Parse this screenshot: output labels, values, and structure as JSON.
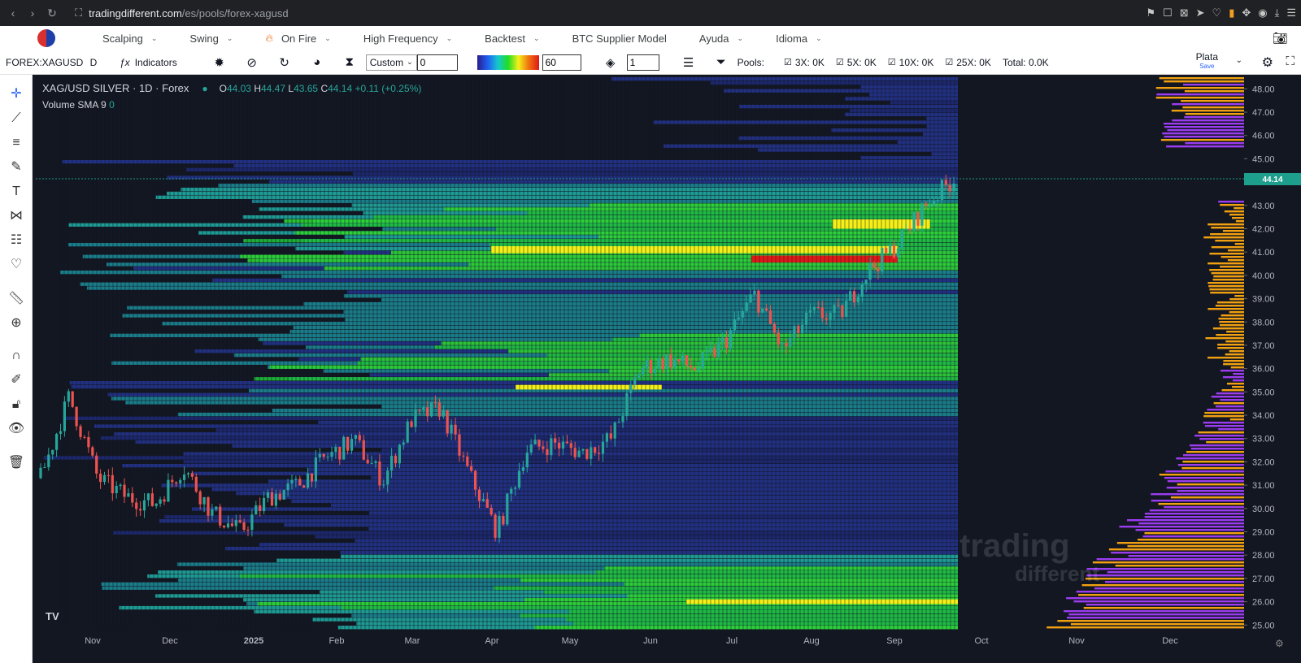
{
  "browser": {
    "back": "‹",
    "forward": "›",
    "reload": "↻",
    "url_domain": "tradingdifferent.com",
    "url_path": "/es/pools/forex-xagusd"
  },
  "site_nav": {
    "items": [
      {
        "label": "Scalping"
      },
      {
        "label": "Swing"
      },
      {
        "label": "On Fire"
      },
      {
        "label": "High Frequency"
      },
      {
        "label": "Backtest"
      },
      {
        "label": "BTC Supplier Model"
      },
      {
        "label": "Ayuda"
      },
      {
        "label": "Idioma"
      }
    ]
  },
  "toolbar": {
    "symbol": "FOREX:XAGUSD",
    "timeframe": "D",
    "indicators_label": "Indicators",
    "mode_select": "Custom",
    "custom_value": "0",
    "gradient_value": "60",
    "layers_value": "1",
    "pools_label": "Pools:",
    "pools": [
      "3X: 0K",
      "5X: 0K",
      "10X: 0K",
      "25X: 0K"
    ],
    "total": "Total: 0.0K",
    "asset_name": "Plata",
    "save_label": "Save"
  },
  "legend": {
    "title": "XAG/USD SILVER · 1D · Forex",
    "o_label": "O",
    "o_value": "44.03",
    "h_label": "H",
    "h_value": "44.47",
    "l_label": "L",
    "l_value": "43.65",
    "c_label": "C",
    "c_value": "44.14",
    "change": "+0.11 (+0.25%)",
    "volume_label": "Volume SMA 9",
    "volume_value": "0"
  },
  "watermark": {
    "line1": "trading",
    "line2": "different"
  },
  "colors": {
    "background": "#131722",
    "bull": "#26a69a",
    "bear": "#ef5350",
    "price_badge": "#1e9e8c",
    "profile_purple": "#9b3cf0",
    "profile_orange": "#f0a010"
  },
  "chart_data": {
    "type": "candlestick-heatmap",
    "current_price": 44.14,
    "current_price_label": "44.14",
    "ylim": [
      24.8,
      48.5
    ],
    "y_ticks": [
      "48.00",
      "47.00",
      "46.00",
      "45.00",
      "44.00",
      "43.00",
      "42.00",
      "41.00",
      "40.00",
      "39.00",
      "38.00",
      "37.00",
      "36.00",
      "35.00",
      "34.00",
      "33.00",
      "32.00",
      "31.00",
      "30.00",
      "29.00",
      "28.00",
      "27.00",
      "26.00",
      "25.00"
    ],
    "x_ticks": [
      "Nov",
      "Dec",
      "2025",
      "Feb",
      "Mar",
      "Apr",
      "May",
      "Jun",
      "Jul",
      "Aug",
      "Sep",
      "Oct",
      "Nov",
      "Dec"
    ],
    "price_path": [
      {
        "date": "Oct 21",
        "close": 31.3
      },
      {
        "date": "Oct 30",
        "close": 34.8
      },
      {
        "date": "Nov 08",
        "close": 31.3
      },
      {
        "date": "Nov 18",
        "close": 30.5
      },
      {
        "date": "Nov 29",
        "close": 30.2
      },
      {
        "date": "Dec 10",
        "close": 31.8
      },
      {
        "date": "Dec 20",
        "close": 29.8
      },
      {
        "date": "Dec 31",
        "close": 29.0
      },
      {
        "date": "Jan 15",
        "close": 30.5
      },
      {
        "date": "Jan 28",
        "close": 31.0
      },
      {
        "date": "Feb 10",
        "close": 32.2
      },
      {
        "date": "Feb 20",
        "close": 32.9
      },
      {
        "date": "Mar 01",
        "close": 31.2
      },
      {
        "date": "Mar 15",
        "close": 33.8
      },
      {
        "date": "Mar 28",
        "close": 34.3
      },
      {
        "date": "Apr 03",
        "close": 31.5
      },
      {
        "date": "Apr 09",
        "close": 29.0
      },
      {
        "date": "Apr 18",
        "close": 32.5
      },
      {
        "date": "Apr 30",
        "close": 32.8
      },
      {
        "date": "May 15",
        "close": 32.4
      },
      {
        "date": "May 30",
        "close": 33.0
      },
      {
        "date": "Jun 06",
        "close": 36.0
      },
      {
        "date": "Jun 18",
        "close": 36.4
      },
      {
        "date": "Jun 30",
        "close": 36.0
      },
      {
        "date": "Jul 10",
        "close": 37.2
      },
      {
        "date": "Jul 22",
        "close": 39.2
      },
      {
        "date": "Jul 31",
        "close": 36.8
      },
      {
        "date": "Aug 10",
        "close": 38.3
      },
      {
        "date": "Aug 22",
        "close": 38.3
      },
      {
        "date": "Aug 31",
        "close": 40.2
      },
      {
        "date": "Sep 10",
        "close": 41.3
      },
      {
        "date": "Sep 16",
        "close": 43.0
      },
      {
        "date": "Sep 22",
        "close": 44.14
      }
    ]
  }
}
